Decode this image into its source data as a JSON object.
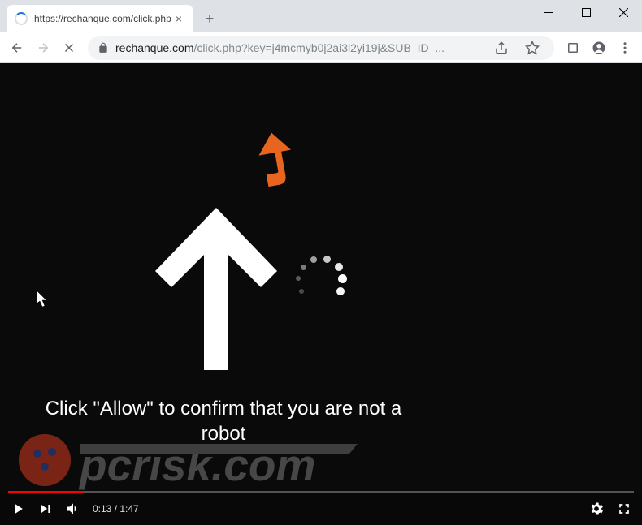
{
  "tab": {
    "title": "https://rechanque.com/click.php"
  },
  "address": {
    "domain": "rechanque.com",
    "path": "/click.php?key=j4mcmyb0j2ai3l2yi19j&SUB_ID_..."
  },
  "page": {
    "message": "Click \"Allow\" to confirm that you are not a robot"
  },
  "video": {
    "current_time": "0:13",
    "duration": "1:47"
  },
  "watermark": {
    "text": "pcrisk.com"
  },
  "icons": {
    "spinner": "loading-spinner",
    "close": "×",
    "newtab": "+",
    "back": "back-arrow",
    "forward": "forward-arrow",
    "stop": "stop-x",
    "lock": "lock",
    "share": "share",
    "star": "star",
    "extensions": "puzzle",
    "profile": "profile",
    "menu": "kebab",
    "minimize": "minimize",
    "maximize": "maximize",
    "closewin": "close"
  }
}
